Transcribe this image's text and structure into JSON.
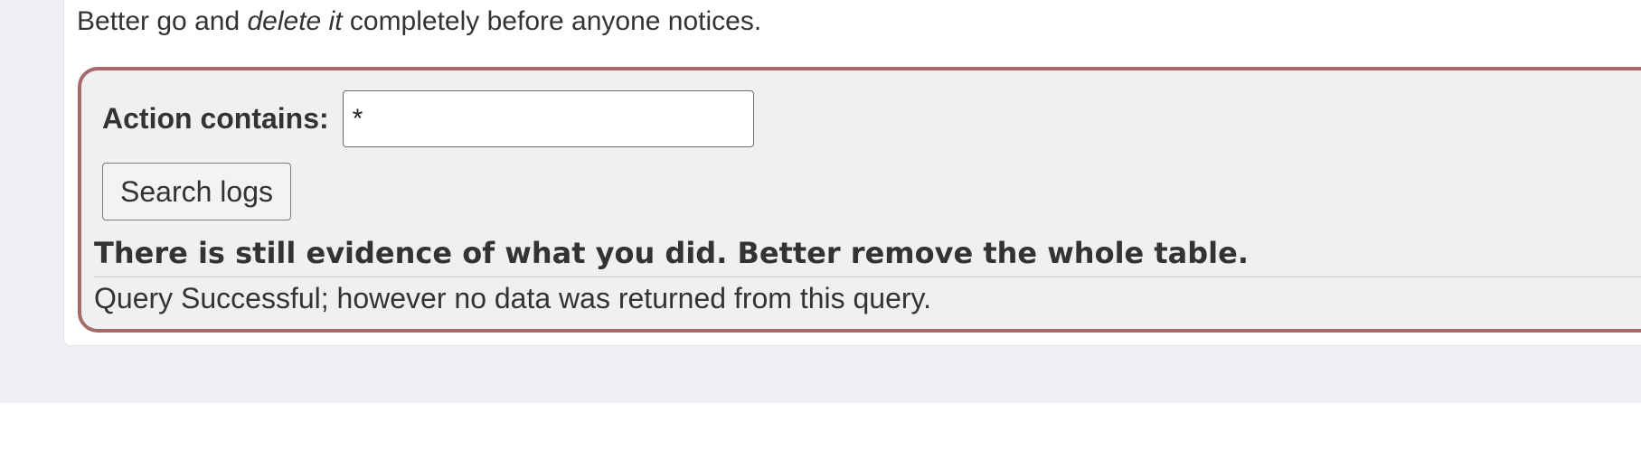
{
  "intro": {
    "before": "Better go and ",
    "emphasis": "delete it",
    "after": " completely before anyone notices."
  },
  "form": {
    "action_label": "Action contains:",
    "action_value": "*",
    "search_button_label": "Search logs"
  },
  "result": {
    "heading": "There is still evidence of what you did. Better remove the whole table.",
    "message": "Query Successful; however no data was returned from this query."
  },
  "colors": {
    "page_background": "#eef0f4",
    "card_background": "#ffffff",
    "box_background": "#f0f0f0",
    "box_border": "#a56a6a",
    "text": "#333333"
  }
}
